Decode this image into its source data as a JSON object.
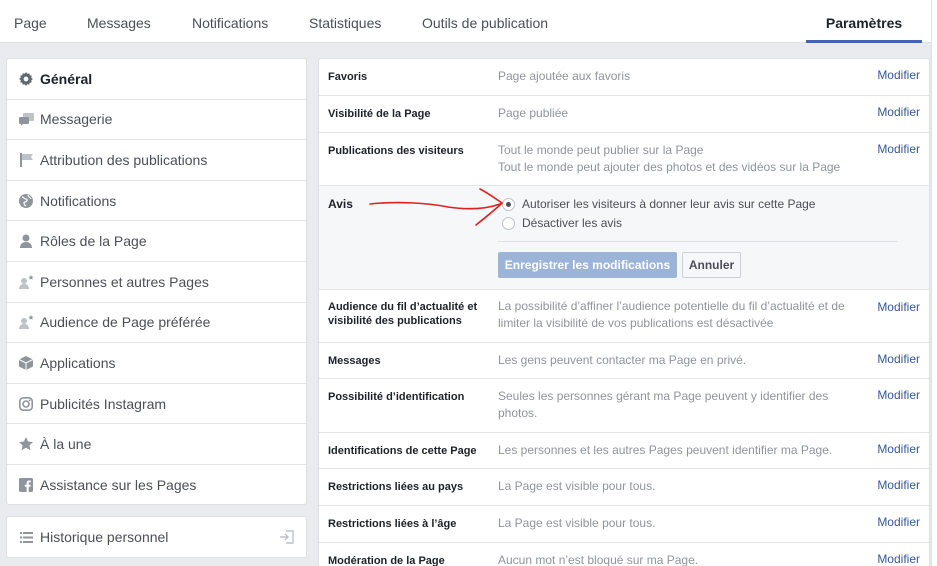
{
  "topnav": {
    "tabs": [
      {
        "label": "Page"
      },
      {
        "label": "Messages"
      },
      {
        "label": "Notifications"
      },
      {
        "label": "Statistiques"
      },
      {
        "label": "Outils de publication"
      },
      {
        "label": "Paramètres"
      }
    ],
    "active_tab": "Paramètres"
  },
  "sidebar": {
    "items": [
      {
        "label": "Général",
        "icon": "gear-icon"
      },
      {
        "label": "Messagerie",
        "icon": "chat-icon"
      },
      {
        "label": "Attribution des publications",
        "icon": "flag-icon"
      },
      {
        "label": "Notifications",
        "icon": "globe-icon"
      },
      {
        "label": "Rôles de la Page",
        "icon": "person-icon"
      },
      {
        "label": "Personnes et autres Pages",
        "icon": "person-star-icon"
      },
      {
        "label": "Audience de Page préférée",
        "icon": "person-star-icon"
      },
      {
        "label": "Applications",
        "icon": "cube-icon"
      },
      {
        "label": "Publicités Instagram",
        "icon": "instagram-icon"
      },
      {
        "label": "À la une",
        "icon": "star-icon"
      },
      {
        "label": "Assistance sur les Pages",
        "icon": "facebook-icon"
      }
    ],
    "history": {
      "label": "Historique personnel",
      "icon": "list-icon",
      "exit_icon": "exit-icon"
    }
  },
  "settings": {
    "modify_label": "Modifier",
    "rows": [
      {
        "label": "Favoris",
        "value": "Page ajoutée aux favoris"
      },
      {
        "label": "Visibilité de la Page",
        "value": "Page publiée"
      },
      {
        "label": "Publications des visiteurs",
        "value": "Tout le monde peut publier sur la Page",
        "value2": "Tout le monde peut ajouter des photos et des vidéos sur la Page"
      },
      {
        "label": "Audience du fil d’actualité et visibilité des publications",
        "value": "La possibilité d’affiner l’audience potentielle du fil d’actualité et de limiter la visibilité de vos publications est désactivée"
      },
      {
        "label": "Messages",
        "value": "Les gens peuvent contacter ma Page en privé."
      },
      {
        "label": "Possibilité d’identification",
        "value": "Seules les personnes gérant ma Page peuvent y identifier des photos."
      },
      {
        "label": "Identifications de cette Page",
        "value": "Les personnes et les autres Pages peuvent identifier ma Page."
      },
      {
        "label": "Restrictions liées au pays",
        "value": "La Page est visible pour tous."
      },
      {
        "label": "Restrictions liées à l’âge",
        "value": "La Page est visible pour tous."
      },
      {
        "label": "Modération de la Page",
        "value": "Aucun mot n’est bloqué sur ma Page."
      }
    ],
    "avis": {
      "label": "Avis",
      "options": [
        {
          "label": "Autoriser les visiteurs à donner leur avis sur cette Page",
          "checked": true
        },
        {
          "label": "Désactiver les avis",
          "checked": false
        }
      ],
      "save_label": "Enregistrer les modifications",
      "cancel_label": "Annuler"
    }
  },
  "colors": {
    "accent": "#4267b2",
    "link": "#365899",
    "annotation": "#e0201c"
  }
}
